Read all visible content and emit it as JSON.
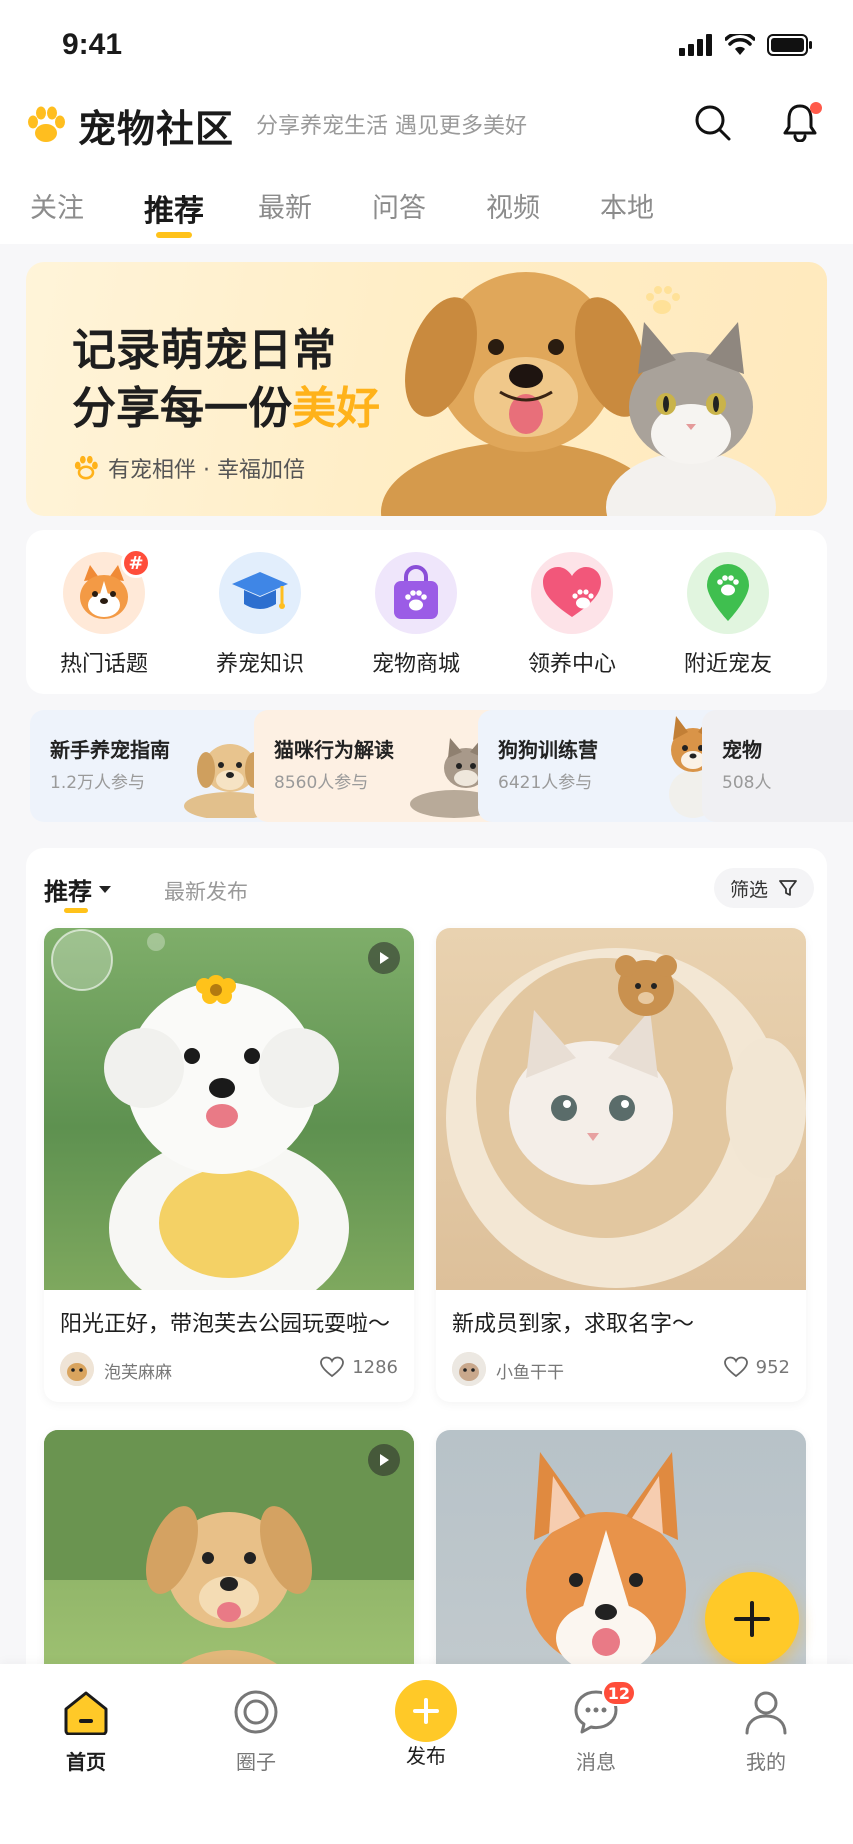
{
  "status_bar": {
    "time": "9:41"
  },
  "header": {
    "app_title": "宠物社区",
    "slogan": "分享养宠生活  遇见更多美好",
    "search_icon": "search-icon",
    "bell_icon": "bell-icon"
  },
  "tabs": [
    {
      "label": "关注",
      "active": false
    },
    {
      "label": "推荐",
      "active": true
    },
    {
      "label": "最新",
      "active": false
    },
    {
      "label": "问答",
      "active": false
    },
    {
      "label": "视频",
      "active": false
    },
    {
      "label": "本地",
      "active": false
    }
  ],
  "hero": {
    "line1": "记录萌宠日常",
    "line2_prefix": "分享每一份",
    "line2_highlight": "美好",
    "tagline": "有宠相伴 · 幸福加倍"
  },
  "quick_entries": [
    {
      "label": "热门话题",
      "icon": "corgi-icon",
      "badge": "#"
    },
    {
      "label": "养宠知识",
      "icon": "graduation-cap-icon"
    },
    {
      "label": "宠物商城",
      "icon": "shopping-bag-icon"
    },
    {
      "label": "领养中心",
      "icon": "heart-paw-icon"
    },
    {
      "label": "附近宠友",
      "icon": "location-pin-icon"
    }
  ],
  "topics": [
    {
      "title": "新手养宠指南",
      "count": "1.2万人参与"
    },
    {
      "title": "猫咪行为解读",
      "count": "8560人参与"
    },
    {
      "title": "狗狗训练营",
      "count": "6421人参与"
    },
    {
      "title": "宠物",
      "count": "508人"
    }
  ],
  "feed": {
    "sort_label": "推荐",
    "latest_label": "最新发布",
    "filter_label": "筛选",
    "posts": [
      {
        "title": "阳光正好，带泡芙去公园玩耍啦～",
        "author": "泡芙麻麻",
        "likes": "1286",
        "video": true
      },
      {
        "title": "新成员到家，求取名字～",
        "author": "小鱼干干",
        "likes": "952",
        "video": false
      },
      {
        "title": "",
        "author": "",
        "likes": "",
        "video": true
      },
      {
        "title": "",
        "author": "",
        "likes": "",
        "video": false
      }
    ]
  },
  "fab": {
    "icon": "plus-icon"
  },
  "bottom_nav": [
    {
      "label": "首页",
      "icon": "home-icon",
      "active": true
    },
    {
      "label": "圈子",
      "icon": "circle-icon",
      "active": false
    },
    {
      "label": "发布",
      "icon": "plus-icon",
      "active": false
    },
    {
      "label": "消息",
      "icon": "chat-icon",
      "active": false,
      "badge": "12"
    },
    {
      "label": "我的",
      "icon": "user-icon",
      "active": false
    }
  ],
  "colors": {
    "accent": "#ffc21a",
    "badge": "#ff4d3a",
    "highlight": "#ffb21a"
  }
}
